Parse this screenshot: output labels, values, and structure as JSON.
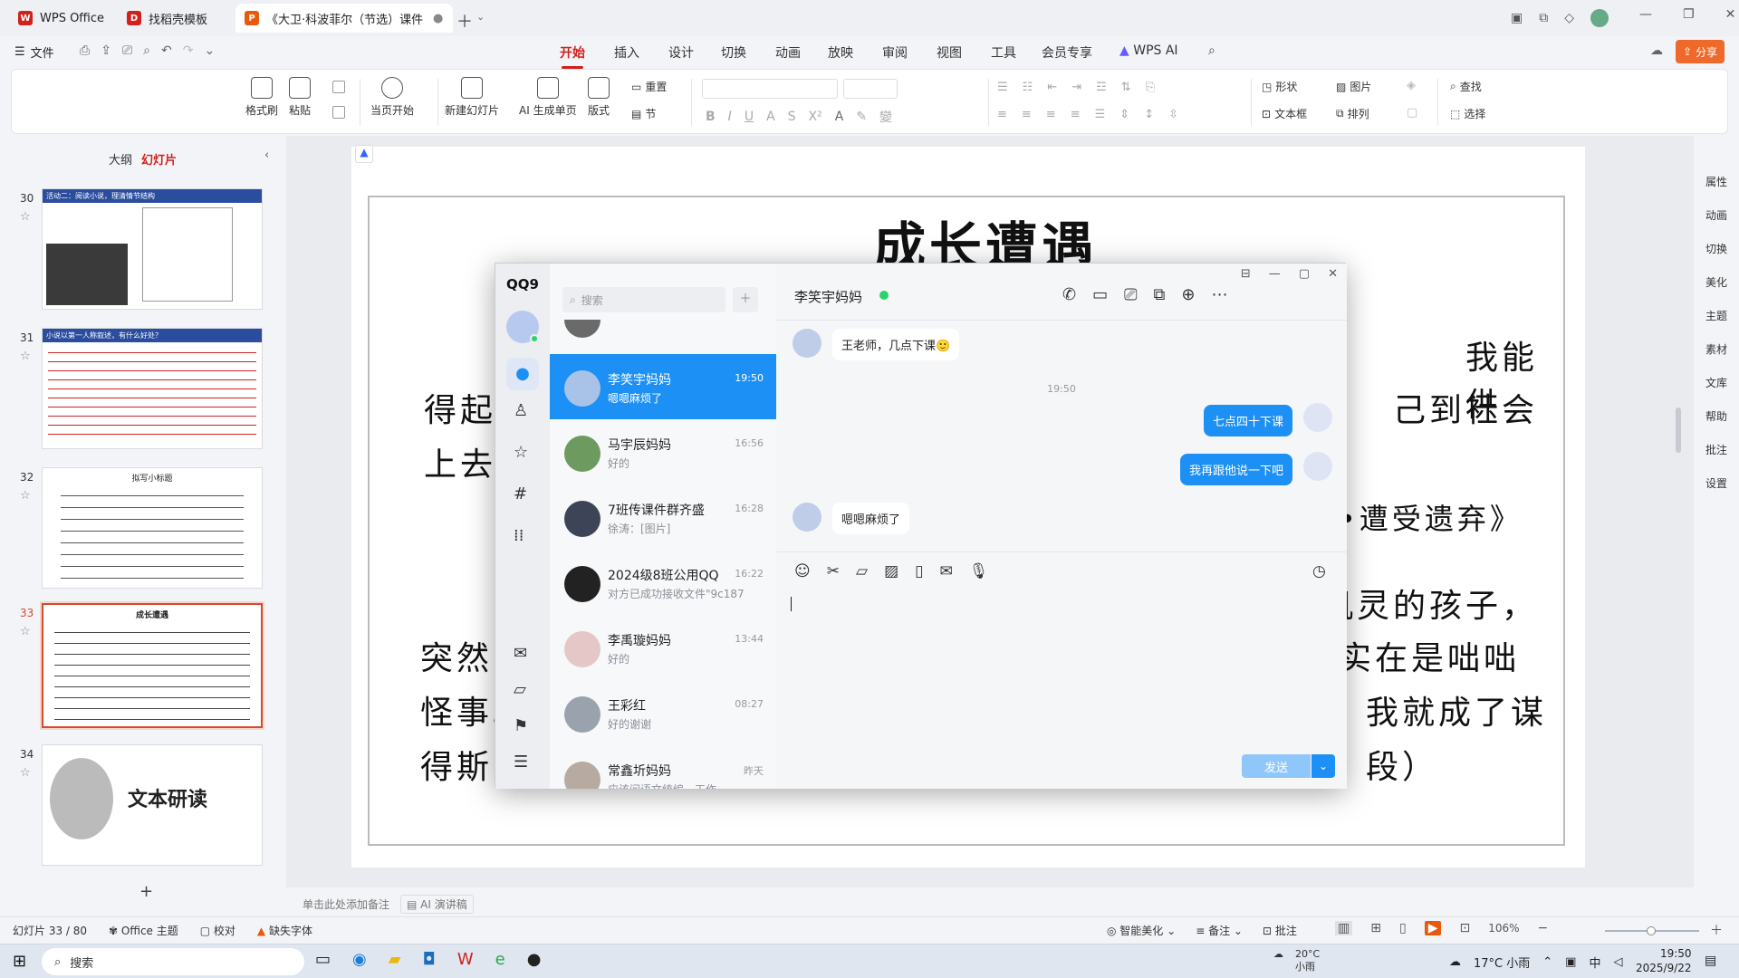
{
  "tabs": [
    {
      "label": "WPS Office",
      "color": "#d0211c"
    },
    {
      "label": "找稻壳模板",
      "color": "#d0211c"
    },
    {
      "label": "《大卫·科波菲尔（节选）课件",
      "color": "#e8590c"
    }
  ],
  "menu": {
    "file": "文件",
    "items": [
      "开始",
      "插入",
      "设计",
      "切换",
      "动画",
      "放映",
      "审阅",
      "视图",
      "工具",
      "会员专享",
      "WPS AI"
    ],
    "active": "开始",
    "share": "分享"
  },
  "ribbon": {
    "format_painter": "格式刷",
    "paste": "粘贴",
    "from_current": "当页开始",
    "new_slide": "新建幻灯片",
    "ai_single": "AI 生成单页",
    "layout": "版式",
    "reset": "重置",
    "section": "节",
    "shape": "形状",
    "picture": "图片",
    "textbox": "文本框",
    "arrange": "排列",
    "find": "查找",
    "select": "选择"
  },
  "leftpanel": {
    "outline_tab": "大纲",
    "slides_tab": "幻灯片",
    "slides": [
      {
        "num": "30",
        "title": "活动二：阅读小说，理清情节结构"
      },
      {
        "num": "31",
        "title": "小说以第一人称叙述，有什么好处？"
      },
      {
        "num": "32",
        "title": "拟写小标题"
      },
      {
        "num": "33",
        "title": "成长遭遇"
      },
      {
        "num": "34",
        "title": "文本研读"
      }
    ],
    "add_label": "+"
  },
  "slide": {
    "title": "成长遭遇",
    "lines": [
      "我能供",
      "得起",
      "己到社会",
      "上去",
      "•遭受遗弃》",
      "机灵的孩子，",
      "突然",
      "实在是咄咄",
      "怪事。",
      "我就成了谋",
      "得斯",
      "段）"
    ]
  },
  "qq": {
    "logo": "QQ9",
    "search_placeholder": "搜索",
    "chat_title": "李笑宇妈妈",
    "conversations": [
      {
        "name": "李笑宇妈妈",
        "msg": "嗯嗯麻烦了",
        "time": "19:50"
      },
      {
        "name": "马宇辰妈妈",
        "msg": "好的",
        "time": "16:56"
      },
      {
        "name": "7班传课件群齐盛",
        "msg": "徐涛：[图片]",
        "time": "16:28"
      },
      {
        "name": "2024级8班公用QQ",
        "msg": "对方已成功接收文件\"9c187...",
        "time": "16:22"
      },
      {
        "name": "李禹璇妈妈",
        "msg": "好的",
        "time": "13:44"
      },
      {
        "name": "王彩红",
        "msg": "好的谢谢",
        "time": "08:27"
      },
      {
        "name": "常鑫圻妈妈",
        "msg": "应该问语文统编一工作",
        "time": "昨天"
      }
    ],
    "messages": [
      {
        "dir": "in",
        "text": "王老师，几点下课🙂"
      },
      {
        "dir": "time",
        "text": "19:50"
      },
      {
        "dir": "out",
        "text": "七点四十下课"
      },
      {
        "dir": "out",
        "text": "我再跟他说一下吧"
      },
      {
        "dir": "in",
        "text": "嗯嗯麻烦了"
      }
    ],
    "send_label": "发送"
  },
  "statusbar": {
    "slide_pos": "幻灯片 33 / 80",
    "theme": "Office 主题",
    "proof": "校对",
    "missing_font": "缺失字体",
    "notes_placeholder": "单击此处添加备注",
    "ai_speech": "AI 演讲稿",
    "beautify": "智能美化",
    "notes": "备注",
    "comments": "批注",
    "zoom": "106%"
  },
  "rightpanel": [
    "属性",
    "动画",
    "切换",
    "美化",
    "主题",
    "素材",
    "文库",
    "帮助",
    "批注",
    "设置"
  ],
  "taskbar": {
    "search": "搜索",
    "weather_temp": "20°C",
    "weather_desc": "小雨",
    "tray_weather": "17°C 小雨",
    "ime": "中",
    "time": "19:50",
    "date": "2025/9/22"
  }
}
